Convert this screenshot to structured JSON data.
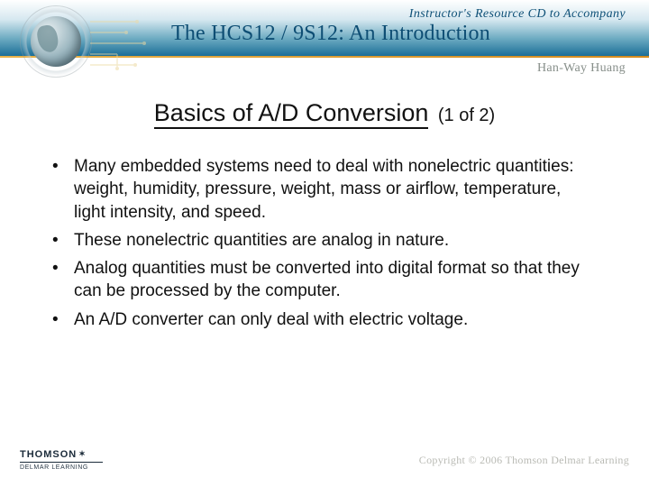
{
  "header": {
    "suptitle": "Instructor's Resource CD to Accompany",
    "main_title": "The HCS12 / 9S12: An Introduction",
    "author": "Han-Way Huang"
  },
  "slide": {
    "title_main": "Basics of A/D Conversion",
    "title_suffix": "(1 of 2)",
    "bullets": [
      "Many embedded systems need to deal with nonelectric quantities: weight, humidity, pressure, weight, mass or airflow, temperature, light intensity, and speed.",
      "These nonelectric quantities are analog in nature.",
      "Analog quantities must be converted into digital format so that they can be processed by the computer.",
      "An A/D converter can only deal with electric voltage."
    ]
  },
  "footer": {
    "brand": "THOMSON",
    "sub": "DELMAR LEARNING",
    "copyright": "Copyright © 2006 Thomson Delmar Learning"
  }
}
